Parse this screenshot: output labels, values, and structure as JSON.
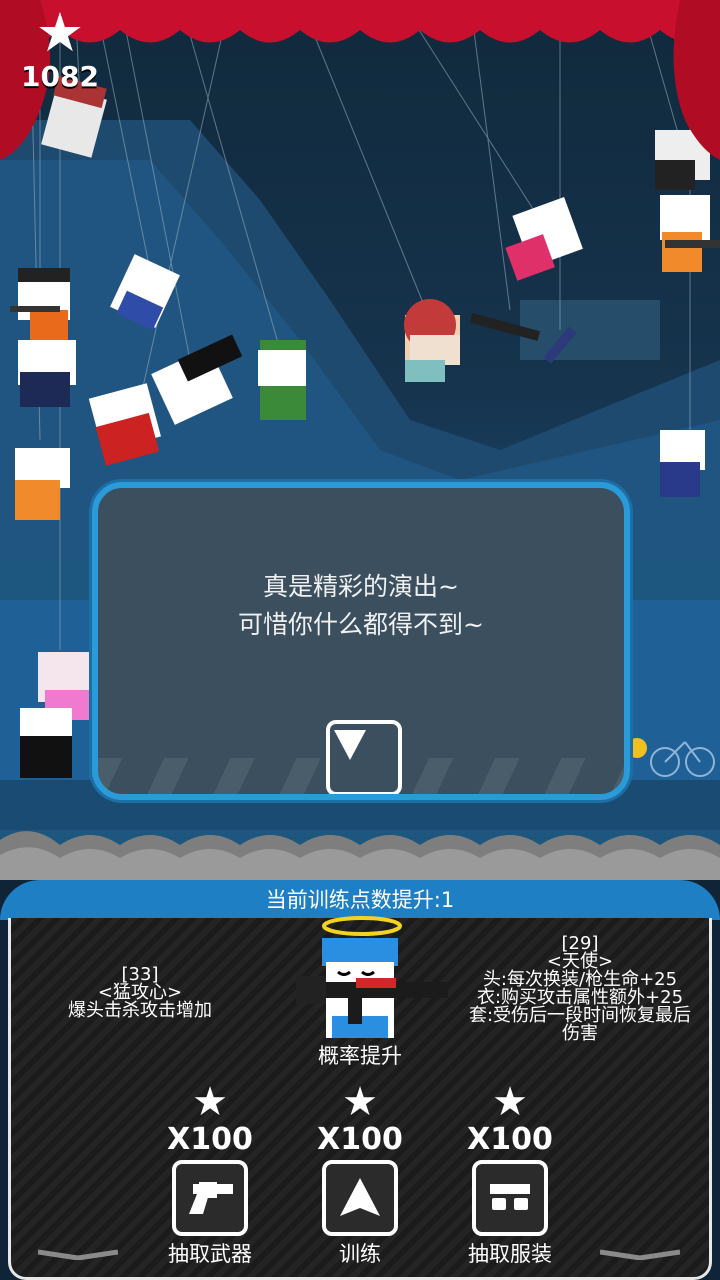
{
  "score": {
    "value": "1082",
    "icon": "star-icon"
  },
  "dialog": {
    "line1": "真是精彩的演出~",
    "line2": "可惜你什么都得不到~",
    "next_icon": "triangle-down-icon"
  },
  "panel": {
    "header": "当前训练点数提升:1",
    "left_skill": {
      "level": "[33]",
      "name": "<猛攻心>",
      "desc": "爆头击杀攻击增加"
    },
    "right_costume": {
      "level": "[29]",
      "name": "<天使>",
      "lines": [
        "头:每次换装/枪生命+25",
        "衣:购买攻击属性额外+25",
        "套:受伤后一段时间恢复最后",
        "伤害"
      ]
    },
    "center_label": "概率提升",
    "actions": [
      {
        "cost": "X100",
        "label": "抽取武器",
        "icon": "revolver-icon"
      },
      {
        "cost": "X100",
        "label": "训练",
        "icon": "arrow-up-icon"
      },
      {
        "cost": "X100",
        "label": "抽取服装",
        "icon": "sunglasses-icon"
      }
    ]
  },
  "colors": {
    "accent": "#2a9ad8",
    "curtain": "#c8102e",
    "stage_blue": "#1b4d78"
  }
}
